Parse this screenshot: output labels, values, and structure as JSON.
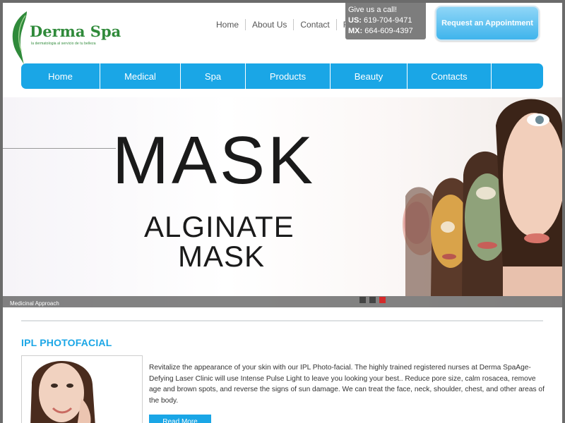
{
  "logo": {
    "name": "Derma Spa",
    "tagline": "la dermatologia al servicio de tu belleza"
  },
  "top_links": [
    "Home",
    "About Us",
    "Contact",
    "FAQ's"
  ],
  "call_box": {
    "heading": "Give us a call!",
    "us_label": "US:",
    "us_phone": "619-704-9471",
    "mx_label": "MX:",
    "mx_phone": "664-609-4397"
  },
  "appointment_button": "Request an Appointment",
  "nav": {
    "items": [
      "Home",
      "Medical",
      "Spa",
      "Products",
      "Beauty",
      "Contacts",
      ""
    ]
  },
  "banner": {
    "headline": "MASK",
    "subline1": "ALGINATE",
    "subline2": "MASK",
    "caption": "Medicinal Approach",
    "slides": 3,
    "active_slide": 3
  },
  "section": {
    "title": "IPL PHOTOFACIAL",
    "description": "Revitalize the appearance of your skin with our IPL Photo-facial. The highly trained registered nurses at Derma SpaAge-Defying Laser Clinic will use Intense Pulse Light to leave you looking your best.. Reduce pore size, calm rosacea, remove age and brown spots, and reverse the signs of sun damage. We can treat the face, neck, shoulder, chest, and other areas of the body.",
    "button": "Read More"
  },
  "colors": {
    "brand_blue": "#1aa6e6",
    "logo_green": "#2f8a3a",
    "active_dot": "#d42a2a"
  }
}
